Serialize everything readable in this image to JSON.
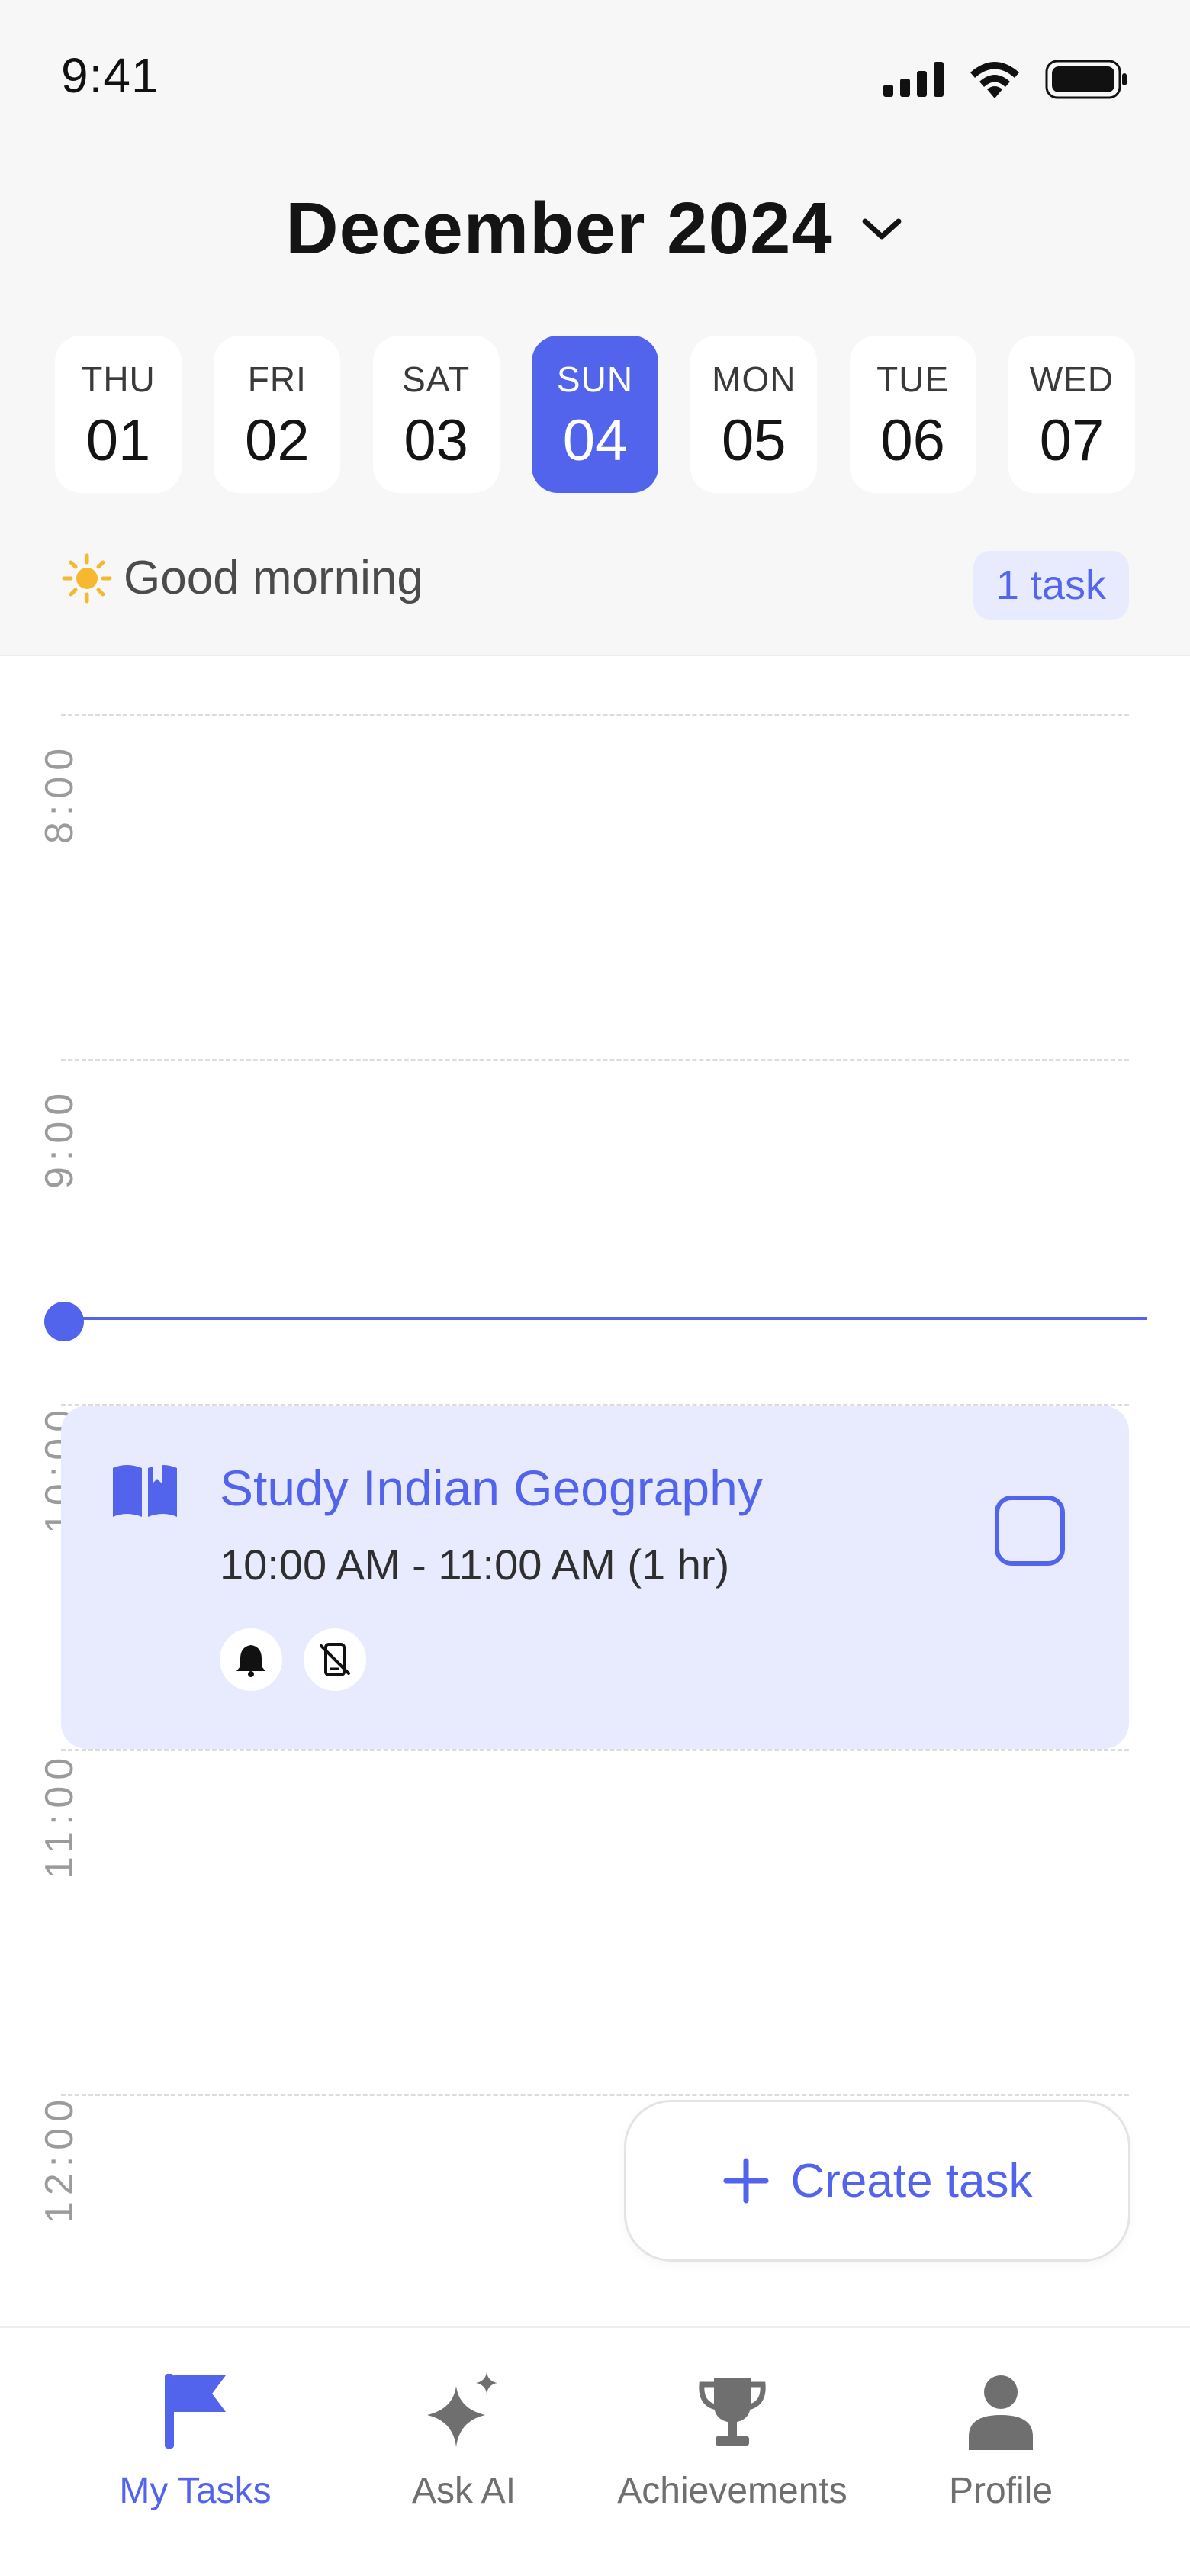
{
  "status_bar": {
    "time": "9:41"
  },
  "header": {
    "month_title": "December 2024",
    "days": [
      {
        "name": "THU",
        "num": "01"
      },
      {
        "name": "FRI",
        "num": "02"
      },
      {
        "name": "SAT",
        "num": "03"
      },
      {
        "name": "SUN",
        "num": "04"
      },
      {
        "name": "MON",
        "num": "05"
      },
      {
        "name": "TUE",
        "num": "06"
      },
      {
        "name": "WED",
        "num": "07"
      }
    ],
    "selected_day": "SUN 04",
    "greeting": "Good morning",
    "task_count": "1 task"
  },
  "timeline": {
    "hours": [
      "8:00",
      "9:00",
      "10:00",
      "11:00",
      "12:00"
    ],
    "task": {
      "title": "Study Indian Geography",
      "time": "10:00 AM - 11:00 AM (1 hr)",
      "icon": "open-book-icon",
      "indicators": [
        "bell-icon",
        "phone-off-icon"
      ]
    },
    "create_task_label": "Create task"
  },
  "bottom_nav": {
    "items": [
      {
        "label": "My Tasks",
        "icon": "flag-icon"
      },
      {
        "label": "Ask AI",
        "icon": "sparkle-icon"
      },
      {
        "label": "Achievements",
        "icon": "trophy-icon"
      },
      {
        "label": "Profile",
        "icon": "person-icon"
      }
    ],
    "active": "My Tasks"
  },
  "colors": {
    "accent": "#5263ec",
    "accent_light": "#e8eafd",
    "header_bg": "#f7f7f7",
    "sun": "#f5b82e"
  }
}
